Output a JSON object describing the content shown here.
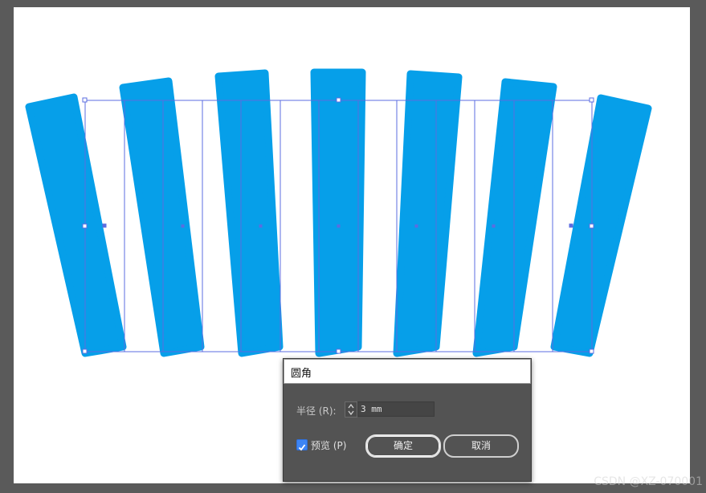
{
  "canvas": {
    "shape_color": "#069fe9",
    "selection_color": "#5b6ce0",
    "shape_count": 7
  },
  "dialog": {
    "title": "圆角",
    "radius_label": "半径 (R):",
    "radius_value": "3 mm",
    "preview_label": "预览 (P)",
    "preview_checked": true,
    "ok_label": "确定",
    "cancel_label": "取消"
  },
  "watermark": "CSDN @XZ-070001"
}
